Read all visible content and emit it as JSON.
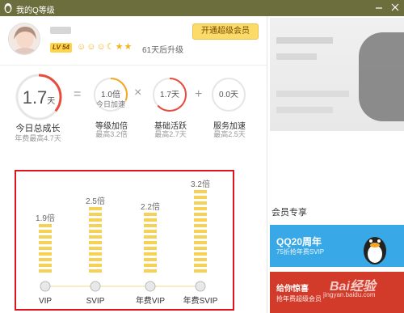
{
  "window": {
    "title": "我的Q等级",
    "minimize_icon": "minimize-icon",
    "close_icon": "close-icon"
  },
  "profile": {
    "level_badge": "LV 54",
    "upgrade_text": "61天后升级",
    "vip_button": "开通超级会员",
    "level_icons": [
      "sun-icon",
      "sun-icon",
      "sun-icon",
      "moon-icon",
      "star-icon",
      "star-icon"
    ]
  },
  "growth": {
    "total": {
      "value": "1.7",
      "unit": "天",
      "label": "今日总成长",
      "sub": "年费最高4.7天",
      "fraction": 0.36
    },
    "operators": {
      "eq": "=",
      "times": "×",
      "plus": "+"
    },
    "level_bonus": {
      "value": "1.0倍",
      "note": "今日加速",
      "label": "等级加倍",
      "sub": "最高3.2倍",
      "fraction": 0.31
    },
    "base_active": {
      "value": "1.7天",
      "label": "基础活跃",
      "sub": "最高2.7天",
      "fraction": 0.63
    },
    "service_boost": {
      "value": "0.0天",
      "label": "服务加速",
      "sub": "最高2.5天",
      "fraction": 0
    }
  },
  "colors": {
    "titlebar": "#6d6e3e",
    "accent_orange": "#f5a623",
    "gauge_track": "#e6e6e6",
    "gauge_red": "#e94b3c",
    "highlight_frame": "#e0141c",
    "bar_yellow": "#f7d155"
  },
  "chart_data": {
    "type": "bar",
    "categories": [
      "VIP",
      "SVIP",
      "年费VIP",
      "年费SVIP"
    ],
    "values": [
      1.9,
      2.5,
      2.2,
      3.2
    ],
    "value_labels": [
      "1.9倍",
      "2.5倍",
      "2.2倍",
      "3.2倍"
    ],
    "title": "",
    "xlabel": "",
    "ylabel": "",
    "ylim": [
      0,
      3.5
    ],
    "grid": false
  },
  "right_panel": {
    "member_title": "会员专享",
    "promo1": {
      "title": "QQ20周年",
      "sub": "75折抢年费SVIP"
    },
    "promo2": {
      "title": "给你惊喜",
      "sub": "抢年费超级会员"
    },
    "watermark": "Bai经验",
    "watermark_url": "jingyan.baidu.com"
  }
}
